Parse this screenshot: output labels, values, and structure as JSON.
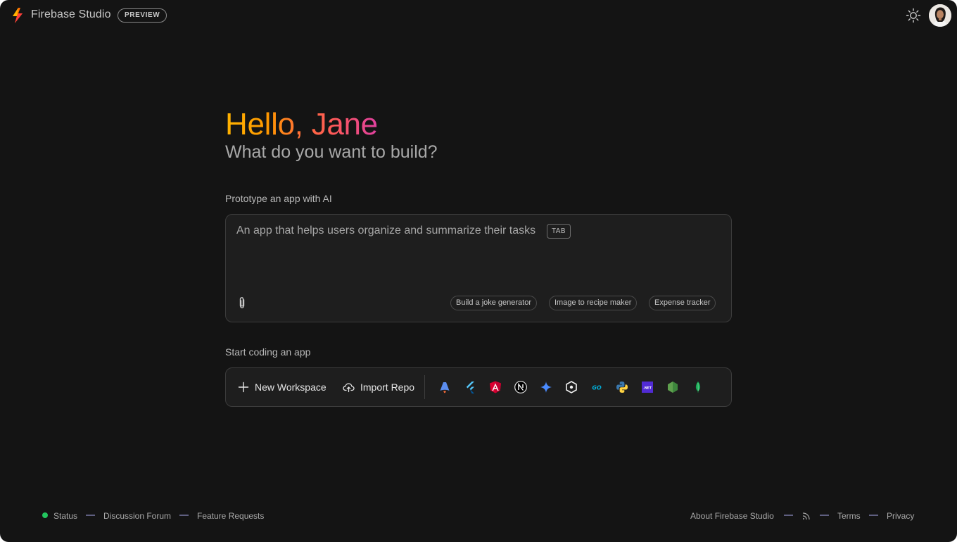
{
  "header": {
    "brand_name": "Firebase Studio",
    "badge": "PREVIEW",
    "icons": [
      "firebase-studio-logo",
      "theme-toggle-sun-icon",
      "user-avatar"
    ]
  },
  "hero": {
    "greeting": "Hello, Jane",
    "subtitle": "What do you want to build?"
  },
  "prototype": {
    "label": "Prototype an app with AI",
    "placeholder": "An app that helps users organize and summarize their tasks",
    "tab_hint": "TAB",
    "suggestions": [
      "Build a joke generator",
      "Image to recipe maker",
      "Expense tracker"
    ]
  },
  "coding": {
    "label": "Start coding an app",
    "new_workspace": "New Workspace",
    "import_repo": "Import Repo",
    "templates": [
      "astro-icon",
      "flutter-icon",
      "angular-icon",
      "nextjs-icon",
      "gemini-icon",
      "ai-sdk-icon",
      "go-icon",
      "python-icon",
      "dotnet-icon",
      "nodejs-icon",
      "mongodb-icon"
    ]
  },
  "footer": {
    "left": [
      "Status",
      "Discussion Forum",
      "Feature Requests"
    ],
    "right": [
      "About Firebase Studio",
      "Terms",
      "Privacy"
    ],
    "status_color": "#22c55e"
  },
  "colors": {
    "background": "#141414",
    "panel": "#1e1e1e",
    "greeting_gradient": [
      "#ffb300",
      "#ff6d3b",
      "#e040a0"
    ]
  }
}
